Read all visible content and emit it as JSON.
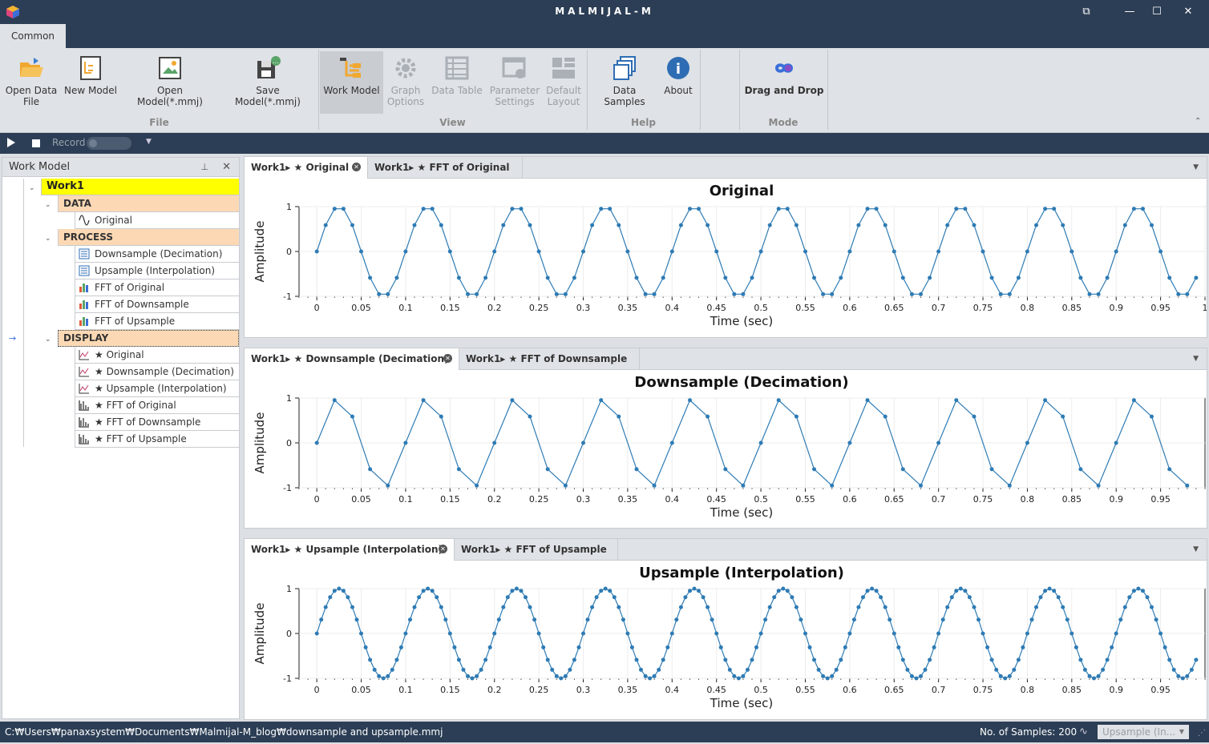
{
  "window": {
    "title": "MALMIJAL-M"
  },
  "ribbon": {
    "tab": "Common",
    "buttons": [
      {
        "label": "Open Data\nFile",
        "group": "File"
      },
      {
        "label": "New Model",
        "group": "File"
      },
      {
        "label": "Open Model(*.mmj)",
        "group": "File"
      },
      {
        "label": "Save Model(*.mmj)",
        "group": "File"
      },
      {
        "label": "Work Model",
        "group": "View",
        "selected": true
      },
      {
        "label": "Graph\nOptions",
        "group": "View",
        "disabled": true
      },
      {
        "label": "Data Table",
        "group": "View",
        "disabled": true
      },
      {
        "label": "Parameter\nSettings",
        "group": "View",
        "disabled": true
      },
      {
        "label": "Default\nLayout",
        "group": "View",
        "disabled": true
      },
      {
        "label": "Data Samples",
        "group": "Help"
      },
      {
        "label": "About",
        "group": "Help"
      },
      {
        "label": "Drag and Drop",
        "group": "Mode"
      }
    ],
    "groups": [
      "File",
      "View",
      "Help",
      "Mode"
    ]
  },
  "toolbar": {
    "record_label": "Record"
  },
  "work_model": {
    "title": "Work Model",
    "root": "Work1",
    "categories": {
      "data": "DATA",
      "process": "PROCESS",
      "display": "DISPLAY"
    },
    "data_items": [
      "Original"
    ],
    "process_items": [
      "Downsample (Decimation)",
      "Upsample (Interpolation)",
      "FFT of Original",
      "FFT of Downsample",
      "FFT of Upsample"
    ],
    "display_items": [
      "★ Original",
      "★ Downsample (Decimation)",
      "★ Upsample (Interpolation)",
      "★ FFT of Original",
      "★ FFT of Downsample",
      "★ FFT of Upsample"
    ]
  },
  "panes": [
    {
      "tabs": [
        "Work1▸ ★ Original",
        "Work1▸ ★ FFT of Original"
      ]
    },
    {
      "tabs": [
        "Work1▸ ★ Downsample (Decimation)",
        "Work1▸ ★ FFT of Downsample"
      ]
    },
    {
      "tabs": [
        "Work1▸ ★ Upsample (Interpolation)",
        "Work1▸ ★ FFT of Upsample"
      ]
    }
  ],
  "chart_data": [
    {
      "type": "line",
      "title": "Original",
      "xlabel": "Time (sec)",
      "ylabel": "Amplitude",
      "x_start": 0,
      "x_step": 0.01,
      "n": 100,
      "frequency_hz": 10,
      "xlim": [
        -0.02,
        1.0
      ],
      "ylim": [
        -1,
        1
      ],
      "x_ticks": [
        "0",
        "0.05",
        "0.1",
        "0.15",
        "0.2",
        "0.25",
        "0.3",
        "0.35",
        "0.4",
        "0.45",
        "0.5",
        "0.55",
        "0.6",
        "0.65",
        "0.7",
        "0.75",
        "0.8",
        "0.85",
        "0.9",
        "0.95",
        "1"
      ],
      "y_ticks": [
        "-1",
        "0",
        "1"
      ],
      "markers": true,
      "color": "#2e7bb4",
      "grid": true
    },
    {
      "type": "line",
      "title": "Downsample (Decimation)",
      "xlabel": "Time (sec)",
      "ylabel": "Amplitude",
      "x_start": 0,
      "x_step": 0.02,
      "n": 50,
      "frequency_hz": 10,
      "xlim": [
        -0.02,
        1.0
      ],
      "ylim": [
        -1,
        1
      ],
      "x_ticks": [
        "0",
        "0.05",
        "0.1",
        "0.15",
        "0.2",
        "0.25",
        "0.3",
        "0.35",
        "0.4",
        "0.45",
        "0.5",
        "0.55",
        "0.6",
        "0.65",
        "0.7",
        "0.75",
        "0.8",
        "0.85",
        "0.9",
        "0.95"
      ],
      "y_ticks": [
        "-1",
        "0",
        "1"
      ],
      "markers": true,
      "color": "#2e7bb4",
      "grid": true
    },
    {
      "type": "line",
      "title": "Upsample (Interpolation)",
      "xlabel": "Time (sec)",
      "ylabel": "Amplitude",
      "x_start": 0,
      "x_step": 0.005,
      "n": 199,
      "frequency_hz": 10,
      "xlim": [
        -0.02,
        1.0
      ],
      "ylim": [
        -1,
        1
      ],
      "x_ticks": [
        "0",
        "0.05",
        "0.1",
        "0.15",
        "0.2",
        "0.25",
        "0.3",
        "0.35",
        "0.4",
        "0.45",
        "0.5",
        "0.55",
        "0.6",
        "0.65",
        "0.7",
        "0.75",
        "0.8",
        "0.85",
        "0.9",
        "0.95"
      ],
      "y_ticks": [
        "-1",
        "0",
        "1"
      ],
      "markers": true,
      "color": "#2e7bb4",
      "grid": true
    }
  ],
  "status": {
    "path": "C:₩Users₩panaxsystem₩Documents₩Malmijal-M_blog₩downsample and upsample.mmj",
    "samples": "No. of Samples: 200",
    "combo": "Upsample (In..."
  },
  "colors": {
    "title_bar": "#2c3e55",
    "ribbon": "#dfe2e6",
    "work1": "#ffff00",
    "category": "#fcd9b4",
    "series": "#2e7bb4"
  }
}
